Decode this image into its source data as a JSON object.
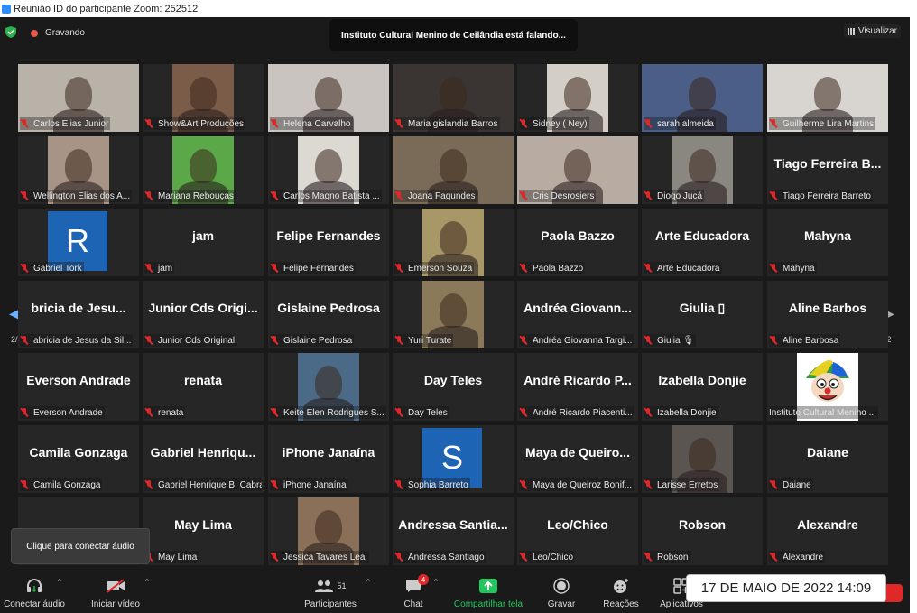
{
  "window_title": "Reunião ID do participante Zoom: 252512",
  "recording_label": "Gravando",
  "speaking_banner": "Instituto Cultural Menino de Ceilândia está falando...",
  "view_button": "Visualizar",
  "page_indicator_left": "2/2",
  "page_indicator_right": "2/2",
  "tooltip": "Clique para conectar áudio",
  "tiles": [
    {
      "label": "Carlos Elias Junior",
      "big": "",
      "kind": "photo",
      "bg": "#b8b2a8"
    },
    {
      "label": "Show&Art Produções",
      "big": "",
      "kind": "photo",
      "bg": "#7a5c48"
    },
    {
      "label": "Helena Carvalho",
      "big": "",
      "kind": "photo",
      "bg": "#c9c4c0"
    },
    {
      "label": "Maria gislandia Barros",
      "big": "",
      "kind": "photo",
      "bg": "#3a3532"
    },
    {
      "label": "Sidney ( Ney)",
      "big": "",
      "kind": "photo",
      "bg": "#d4cfc6"
    },
    {
      "label": "sarah almeida",
      "big": "",
      "kind": "photo",
      "bg": "#4a5e88"
    },
    {
      "label": "Guilherme Lira Martins",
      "big": "",
      "kind": "photo",
      "bg": "#d8d5d0"
    },
    {
      "label": "Wellington Elias dos A...",
      "big": "",
      "kind": "photo",
      "bg": "#a89486"
    },
    {
      "label": "Mariana Rebouças",
      "big": "",
      "kind": "photo",
      "bg": "#5aa848"
    },
    {
      "label": "Carlos Magno Batista ...",
      "big": "",
      "kind": "photo",
      "bg": "#dcd8d2"
    },
    {
      "label": "Joana Fagundes",
      "big": "",
      "kind": "photo",
      "bg": "#7a6a58"
    },
    {
      "label": "Cris Desrosiers",
      "big": "",
      "kind": "photo",
      "bg": "#b8aca2"
    },
    {
      "label": "Diogo Jucá",
      "big": "",
      "kind": "photo",
      "bg": "#8a8680"
    },
    {
      "label": "Tiago Ferreira Barreto",
      "big": "Tiago Ferreira B...",
      "kind": "name",
      "bg": ""
    },
    {
      "label": "Gabriel Tork",
      "big": "R",
      "kind": "avatar",
      "bg": "#1e64b4"
    },
    {
      "label": "jam",
      "big": "jam",
      "kind": "name",
      "bg": ""
    },
    {
      "label": "Felipe Fernandes",
      "big": "Felipe Fernandes",
      "kind": "name",
      "bg": ""
    },
    {
      "label": "Emerson Souza",
      "big": "",
      "kind": "photo",
      "bg": "#a89868"
    },
    {
      "label": "Paola Bazzo",
      "big": "Paola Bazzo",
      "kind": "name",
      "bg": ""
    },
    {
      "label": "Arte Educadora",
      "big": "Arte Educadora",
      "kind": "name",
      "bg": ""
    },
    {
      "label": "Mahyna",
      "big": "Mahyna",
      "kind": "name",
      "bg": ""
    },
    {
      "label": "abricia de Jesus da Sil...",
      "big": "bricia de Jesu...",
      "kind": "name",
      "bg": ""
    },
    {
      "label": "Junior Cds Original",
      "big": "Junior Cds Origi...",
      "kind": "name",
      "bg": ""
    },
    {
      "label": "Gislaine Pedrosa",
      "big": "Gislaine Pedrosa",
      "kind": "name",
      "bg": ""
    },
    {
      "label": "Yuri Turate",
      "big": "",
      "kind": "photo",
      "bg": "#8a7a5a"
    },
    {
      "label": "Andréa Giovanna Targi...",
      "big": "Andréa Giovann...",
      "kind": "name",
      "bg": ""
    },
    {
      "label": "Giulia 🎙",
      "big": "Giulia ▯",
      "kind": "name",
      "bg": ""
    },
    {
      "label": "Aline Barbosa",
      "big": "Aline Barbos",
      "kind": "name",
      "bg": ""
    },
    {
      "label": "Everson Andrade",
      "big": "Everson Andrade",
      "kind": "name",
      "bg": ""
    },
    {
      "label": "renata",
      "big": "renata",
      "kind": "name",
      "bg": ""
    },
    {
      "label": "Keite Elen Rodrigues S...",
      "big": "",
      "kind": "photo",
      "bg": "#4a6a88"
    },
    {
      "label": "Day Teles",
      "big": "Day Teles",
      "kind": "name",
      "bg": ""
    },
    {
      "label": "André Ricardo Piacenti...",
      "big": "André Ricardo P...",
      "kind": "name",
      "bg": ""
    },
    {
      "label": "Izabella Donjie",
      "big": "Izabella Donjie",
      "kind": "name",
      "bg": ""
    },
    {
      "label": "Instituto Cultural Menino ...",
      "big": "",
      "kind": "logo",
      "bg": "#ffffff"
    },
    {
      "label": "Camila Gonzaga",
      "big": "Camila Gonzaga",
      "kind": "name",
      "bg": ""
    },
    {
      "label": "Gabriel Henrique B. Cabral",
      "big": "Gabriel Henriqu...",
      "kind": "name",
      "bg": ""
    },
    {
      "label": "iPhone Janaína",
      "big": "iPhone Janaína",
      "kind": "name",
      "bg": ""
    },
    {
      "label": "Sophia Barreto",
      "big": "S",
      "kind": "avatar",
      "bg": "#1e64b4"
    },
    {
      "label": "Maya de Queiroz Bonif...",
      "big": "Maya de Queiro...",
      "kind": "name",
      "bg": ""
    },
    {
      "label": "Larisse Erretos",
      "big": "",
      "kind": "photo",
      "bg": "#5a5550"
    },
    {
      "label": "Daiane",
      "big": "Daiane",
      "kind": "name",
      "bg": ""
    },
    {
      "label": "",
      "big": "",
      "kind": "name",
      "bg": ""
    },
    {
      "label": "May Lima",
      "big": "May Lima",
      "kind": "name",
      "bg": ""
    },
    {
      "label": "Jessica Tavares Leal",
      "big": "",
      "kind": "photo",
      "bg": "#8a7058"
    },
    {
      "label": "Andressa Santiago",
      "big": "Andressa Santia...",
      "kind": "name",
      "bg": ""
    },
    {
      "label": "Leo/Chico",
      "big": "Leo/Chico",
      "kind": "name",
      "bg": ""
    },
    {
      "label": "Robson",
      "big": "Robson",
      "kind": "name",
      "bg": ""
    },
    {
      "label": "Alexandre",
      "big": "Alexandre",
      "kind": "name",
      "bg": ""
    }
  ],
  "toolbar": {
    "audio": "Conectar áudio",
    "video": "Iniciar vídeo",
    "participants": "Participantes",
    "participants_count": "51",
    "chat": "Chat",
    "chat_badge": "4",
    "share": "Compartilhar tela",
    "record": "Gravar",
    "reactions": "Reações",
    "apps": "Aplicativos"
  },
  "datestamp": "17 DE MAIO DE 2022 14:09",
  "colors": {
    "share_green": "#23c55e",
    "mute_red": "#e02828",
    "avatar_blue": "#1e64b4",
    "arrow_blue": "#6ab4ff"
  }
}
